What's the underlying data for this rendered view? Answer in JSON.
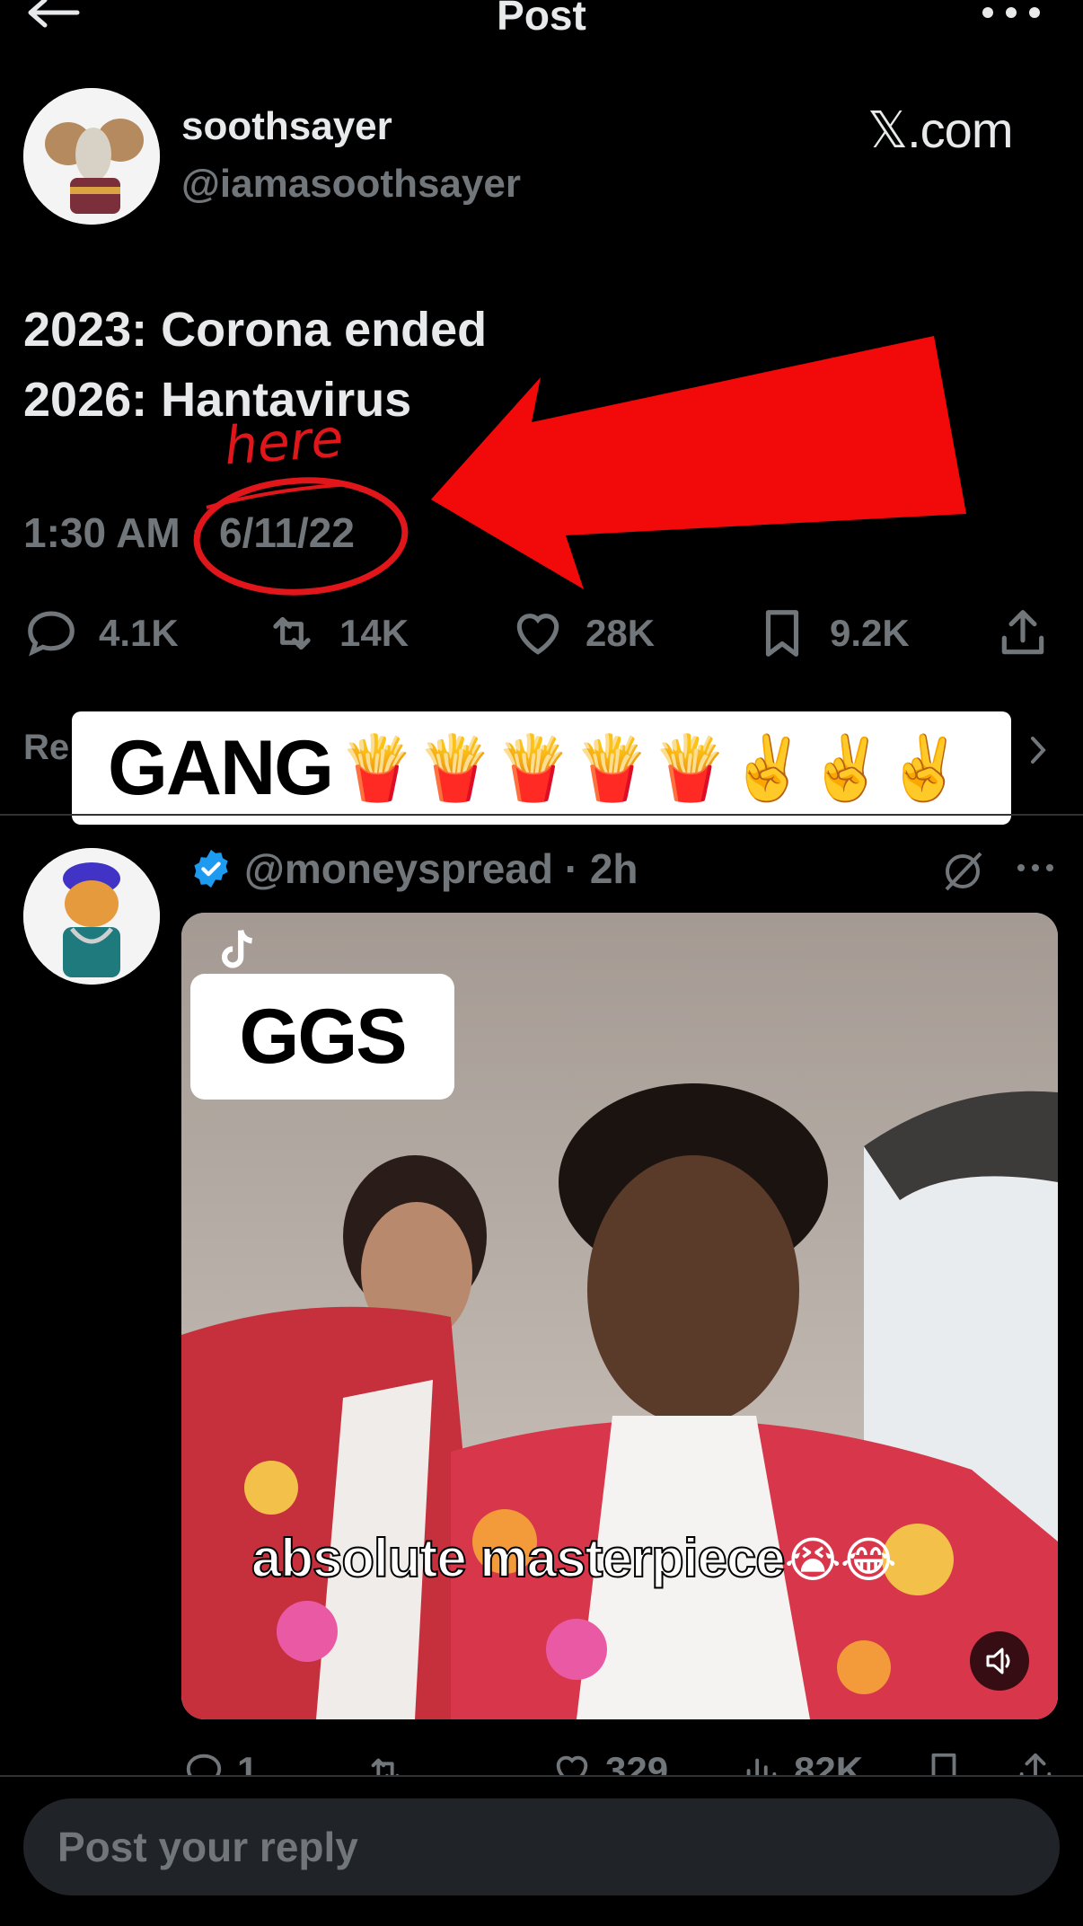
{
  "header": {
    "title": "Post"
  },
  "post": {
    "author": {
      "display_name": "soothsayer",
      "handle": "@iamasoothsayer"
    },
    "watermark": "𝕏.com",
    "lines": [
      "2023: Corona ended",
      "2026: Hantavirus"
    ],
    "annotation_word": "here",
    "time": "1:30 AM ·",
    "date": "6/11/22",
    "stats": {
      "replies": "4.1K",
      "reposts": "14K",
      "likes": "28K",
      "bookmarks": "9.2K"
    }
  },
  "relevant": {
    "label": "Re",
    "sticker_text": "GANG",
    "sticker_emoji": "🍟🍟🍟🍟🍟✌️✌️✌️"
  },
  "reply": {
    "handle": "@moneyspread · 2h",
    "video": {
      "sticker": "GGS",
      "caption": "absolute masterpiece",
      "caption_emoji": "😭😂"
    },
    "stats": {
      "replies": "1",
      "likes": "329",
      "views": "82K"
    }
  },
  "compose": {
    "placeholder": "Post your reply"
  },
  "colors": {
    "background": "#000000",
    "muted": "#71767b",
    "text": "#e7e9ea",
    "annotation_red": "#e0161b",
    "verified": "#1d9bf0"
  },
  "icons": [
    "back-arrow-icon",
    "more-icon",
    "reply-icon",
    "repost-icon",
    "like-icon",
    "bookmark-icon",
    "share-icon",
    "chevron-right-icon",
    "verified-icon",
    "grok-icon",
    "volume-icon",
    "tiktok-icon",
    "views-icon"
  ]
}
